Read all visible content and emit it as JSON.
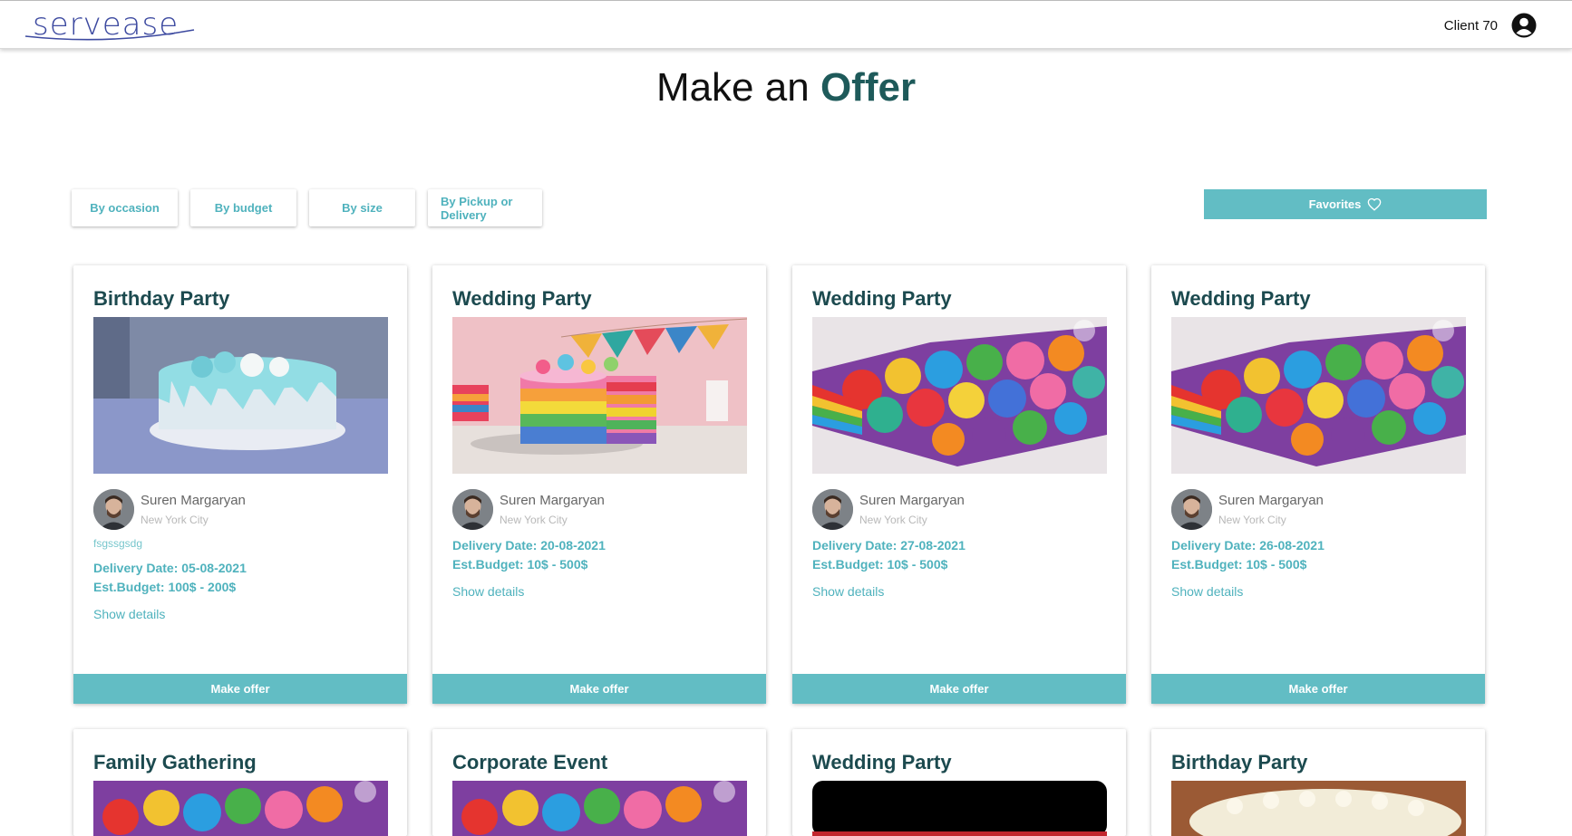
{
  "header": {
    "logo_text": "servease",
    "user_name": "Client 70",
    "user_icon": "account-circle-icon"
  },
  "title": {
    "prefix": "Make an",
    "accent": "Offer"
  },
  "filters": [
    {
      "label": "By occasion"
    },
    {
      "label": "By budget"
    },
    {
      "label": "By size"
    },
    {
      "label": "By Pickup or Delivery"
    }
  ],
  "favorites": {
    "label": "Favorites",
    "icon": "heart-outline-icon"
  },
  "cards": [
    {
      "title": "Birthday Party",
      "image": "blue-drip-cake",
      "person": "Suren Margaryan",
      "city": "New York City",
      "note": "fsgssgsdg",
      "delivery": "Delivery Date: 05-08-2021",
      "budget": "Est.Budget: 100$ - 200$",
      "show": "Show details",
      "action": "Make offer"
    },
    {
      "title": "Wedding Party",
      "image": "rainbow-layer-cake",
      "person": "Suren Margaryan",
      "city": "New York City",
      "note": "",
      "delivery": "Delivery Date: 20-08-2021",
      "budget": "Est.Budget: 10$ - 500$",
      "show": "Show details",
      "action": "Make offer"
    },
    {
      "title": "Wedding Party",
      "image": "rainbow-rose-cake",
      "person": "Suren Margaryan",
      "city": "New York City",
      "note": "",
      "delivery": "Delivery Date: 27-08-2021",
      "budget": "Est.Budget: 10$ - 500$",
      "show": "Show details",
      "action": "Make offer"
    },
    {
      "title": "Wedding Party",
      "image": "rainbow-rose-cake",
      "person": "Suren Margaryan",
      "city": "New York City",
      "note": "",
      "delivery": "Delivery Date: 26-08-2021",
      "budget": "Est.Budget: 10$ - 500$",
      "show": "Show details",
      "action": "Make offer"
    },
    {
      "title": "Family Gathering",
      "image": "rainbow-rose-cake"
    },
    {
      "title": "Corporate Event",
      "image": "rainbow-rose-cake"
    },
    {
      "title": "Wedding Party",
      "image": "black-image"
    },
    {
      "title": "Birthday Party",
      "image": "cream-cake"
    }
  ],
  "colors": {
    "accent": "#62bdc4",
    "title_dark": "#1c4a4f",
    "link": "#4fb2bd"
  }
}
